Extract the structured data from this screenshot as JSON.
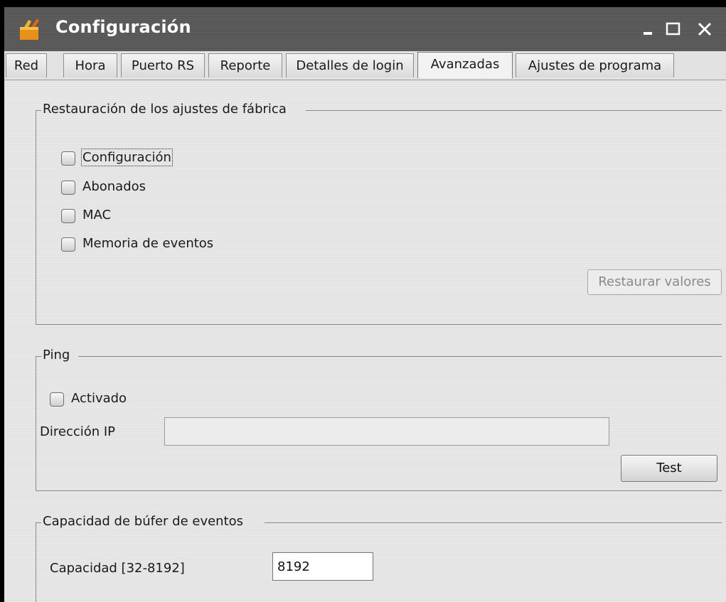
{
  "window": {
    "title": "Configuración",
    "controls": {
      "minimize_icon": "minimize-icon",
      "maximize_icon": "maximize-icon",
      "close_icon": "close-icon"
    }
  },
  "tabs": [
    {
      "label": "Red",
      "active": false
    },
    {
      "label": "Hora",
      "active": false
    },
    {
      "label": "Puerto RS",
      "active": false
    },
    {
      "label": "Reporte",
      "active": false
    },
    {
      "label": "Detalles de login",
      "active": false
    },
    {
      "label": "Avanzadas",
      "active": true
    },
    {
      "label": "Ajustes de programa",
      "active": false
    }
  ],
  "factory_reset": {
    "title": "Restauración de los ajustes de fábrica",
    "options": [
      {
        "label": "Configuración",
        "checked": false
      },
      {
        "label": "Abonados",
        "checked": false
      },
      {
        "label": "MAC",
        "checked": false
      },
      {
        "label": "Memoria de eventos",
        "checked": false
      }
    ],
    "restore_button": "Restaurar valores"
  },
  "ping": {
    "title": "Ping",
    "enabled_label": "Activado",
    "enabled": false,
    "ip_label": "Dirección IP",
    "ip_value": "",
    "test_button": "Test"
  },
  "buffer": {
    "title": "Capacidad de búfer de eventos",
    "capacity_label": "Capacidad [32-8192]",
    "capacity_value": "8192"
  },
  "colors": {
    "titlebar": "#5a5a5a",
    "panel": "#e6e6e6",
    "border": "#8c8c8c"
  }
}
